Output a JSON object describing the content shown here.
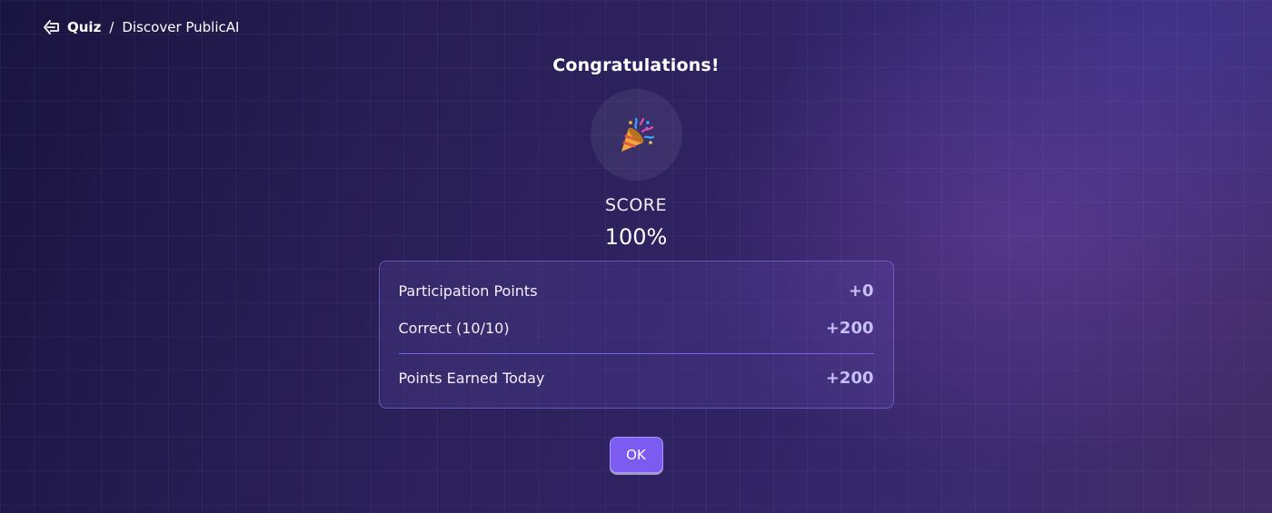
{
  "breadcrumb": {
    "back_icon": "arrow-left-icon",
    "section": "Quiz",
    "separator": "/",
    "page": "Discover PublicAI"
  },
  "result": {
    "title": "Congratulations!",
    "emoji_icon": "party-popper-icon",
    "score_label": "SCORE",
    "score_value": "100%"
  },
  "points": {
    "rows": [
      {
        "label": "Participation Points",
        "value": "+0"
      },
      {
        "label": "Correct (10/10)",
        "value": "+200"
      }
    ],
    "total": {
      "label": "Points Earned Today",
      "value": "+200"
    }
  },
  "actions": {
    "ok_label": "OK"
  },
  "colors": {
    "accent": "#7c5cf0",
    "value_text": "#c9bff8",
    "divider": "#7b63e8"
  }
}
